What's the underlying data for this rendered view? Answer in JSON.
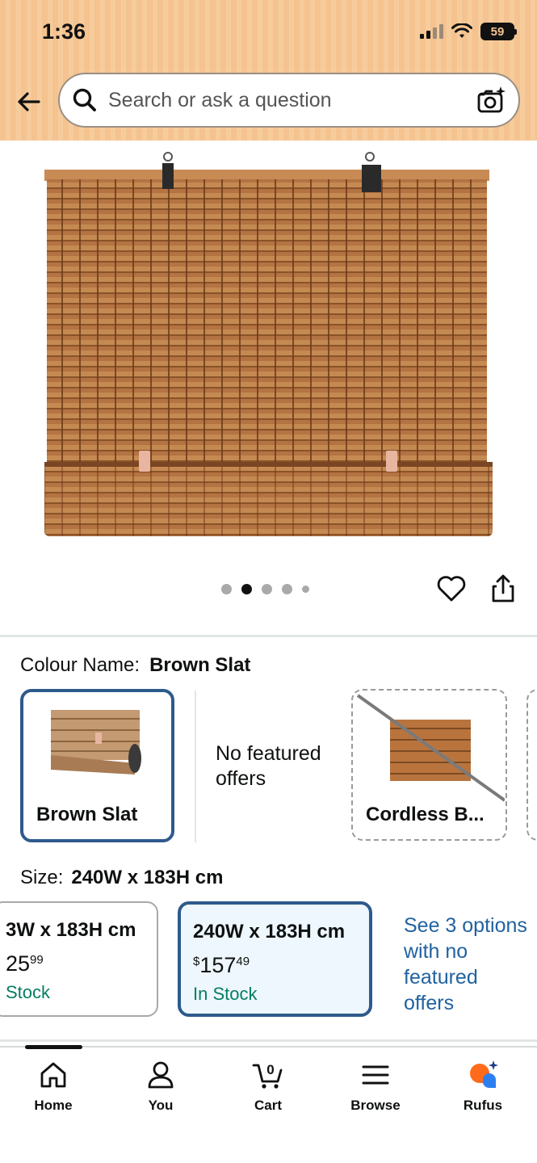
{
  "status_bar": {
    "time": "1:36",
    "battery": "59"
  },
  "search": {
    "placeholder": "Search or ask a question"
  },
  "gallery": {
    "image_count": 5,
    "active_index": 1
  },
  "colour": {
    "label": "Colour Name:",
    "selected": "Brown Slat",
    "options": [
      {
        "label": "Brown Slat"
      },
      {
        "label": "No featured offers"
      },
      {
        "label": "Cordless B..."
      }
    ]
  },
  "size": {
    "label": "Size:",
    "selected": "240W x 183H cm",
    "options": [
      {
        "name": "3W x 183H cm",
        "price_whole": "25",
        "price_fraction": "99",
        "stock": "Stock"
      },
      {
        "name": "240W x 183H cm",
        "currency": "$",
        "price_whole": "157",
        "price_fraction": "49",
        "stock": "In Stock"
      }
    ],
    "see_more": "See 3 options with no featured offers"
  },
  "nav": {
    "home": "Home",
    "you": "You",
    "cart": "Cart",
    "cart_count": "0",
    "browse": "Browse",
    "rufus": "Rufus"
  },
  "colors": {
    "accent": "#2e5a8c",
    "link": "#2162a1",
    "stock_green": "#067d62",
    "header_bg": "#f4c38f"
  }
}
